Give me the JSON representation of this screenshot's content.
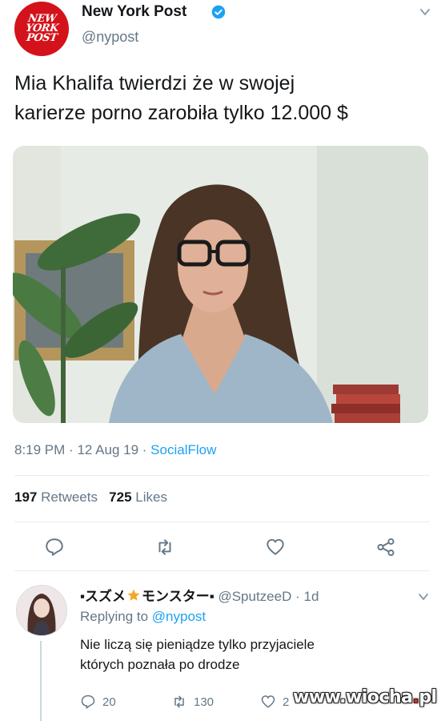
{
  "account": {
    "logo_lines": [
      "NEW",
      "YORK",
      "POST"
    ],
    "name": "New York Post",
    "handle": "@nypost"
  },
  "tweet": {
    "text_line1": "Mia Khalifa twierdzi że w swojej",
    "text_line2": "karierze porno zarobiła tylko 12.000 $",
    "time": "8:19 PM",
    "date": "12 Aug 19",
    "source": "SocialFlow",
    "sep": "·"
  },
  "stats": {
    "retweets_count": "197",
    "retweets_label": "Retweets",
    "likes_count": "725",
    "likes_label": "Likes"
  },
  "reply": {
    "display_name": "▪スズメ",
    "display_name_2": "モンスター▪",
    "handle": "@SputzeeD",
    "age": "1d",
    "sep": "·",
    "replying_prefix": "Replying to",
    "replying_mention": "@nypost",
    "text_line1": "Nie liczą się pieniądze tylko przyjaciele",
    "text_line2": "których poznała po drodze",
    "reply_count": "20",
    "retweet_count": "130",
    "like_count": "2"
  },
  "watermark": {
    "main": "www.wiocha",
    "dot": ".",
    "tld": "pl"
  },
  "colors": {
    "brand_red": "#d4121b",
    "twitter_blue": "#1da1f2",
    "muted_gray": "#657786"
  }
}
